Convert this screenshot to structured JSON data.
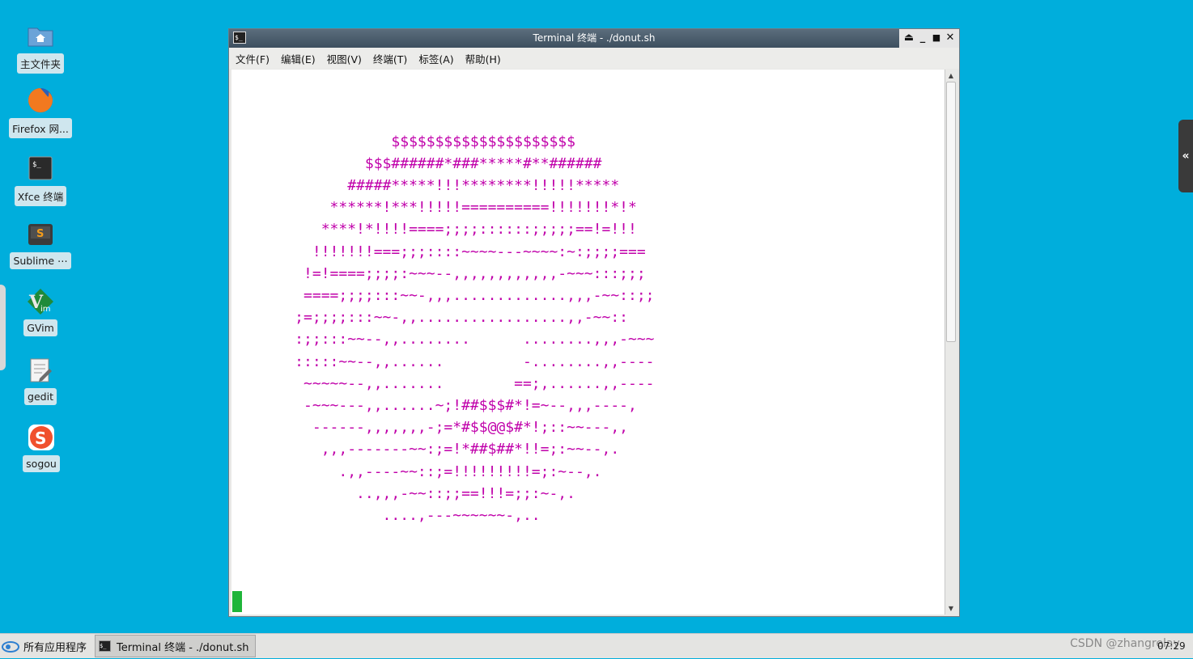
{
  "desktop_icons": [
    {
      "label": "主文件夹",
      "icon": "home-folder-icon"
    },
    {
      "label": "Firefox 网...",
      "icon": "firefox-icon"
    },
    {
      "label": "Xfce 终端",
      "icon": "terminal-icon"
    },
    {
      "label": "Sublime ⋯",
      "icon": "sublime-icon"
    },
    {
      "label": "GVim",
      "icon": "vim-icon"
    },
    {
      "label": "gedit",
      "icon": "gedit-icon"
    },
    {
      "label": "sogou",
      "icon": "sogou-icon"
    }
  ],
  "window": {
    "title": "Terminal 终端 - ./donut.sh",
    "menu": [
      "文件(F)",
      "编辑(E)",
      "视图(V)",
      "终端(T)",
      "标签(A)",
      "帮助(H)"
    ],
    "controls": [
      "⏏",
      "_",
      "■",
      "✕"
    ],
    "text_color": "#c000aa",
    "cursor_color": "#1fb53a"
  },
  "terminal_lines": [
    "",
    "",
    "                $$$$$$$$$$$$$$$$$$$$$",
    "             $$$######*###*****#**######",
    "           #####*****!!!********!!!!!*****",
    "         ******!***!!!!!==========!!!!!!!*!*",
    "        ****!*!!!!====;;;;::::::;;;;;==!=!!!",
    "       !!!!!!!===;;;::::~~~~---~~~~:~:;;;;===",
    "      !=!====;;;;:~~~--,,,,,,,,,,,,-~~~:::;;;",
    "      ====;;;;:::~~-,,,.............,,,-~~::;;",
    "     ;=;;;;:::~~-,,.................,,-~~::",
    "     :;;:::~~--,,........      ........,,,-~~~",
    "     :::::~~--,,......         -........,,----",
    "      ~~~~~--,,.......        ==;,......,,----",
    "      -~~~---,,......~;!##$$$#*!=~--,,,----,",
    "       ------,,,,,,,-;=*#$$@@$#*!;::~~---,,",
    "        ,,,-------~~:;=!*##$##*!!=;:~~--,.",
    "          .,,----~~::;=!!!!!!!!!=;:~--,.",
    "            ..,,,-~~::;;==!!!=;;:~-,.",
    "               ....,---~~~~~~-,.."
  ],
  "taskbar": {
    "start_label": "所有应用程序",
    "task_label": "Terminal 终端 - ./donut.sh",
    "watermark": "CSDN @zhangrelay",
    "clock": "07:29"
  }
}
